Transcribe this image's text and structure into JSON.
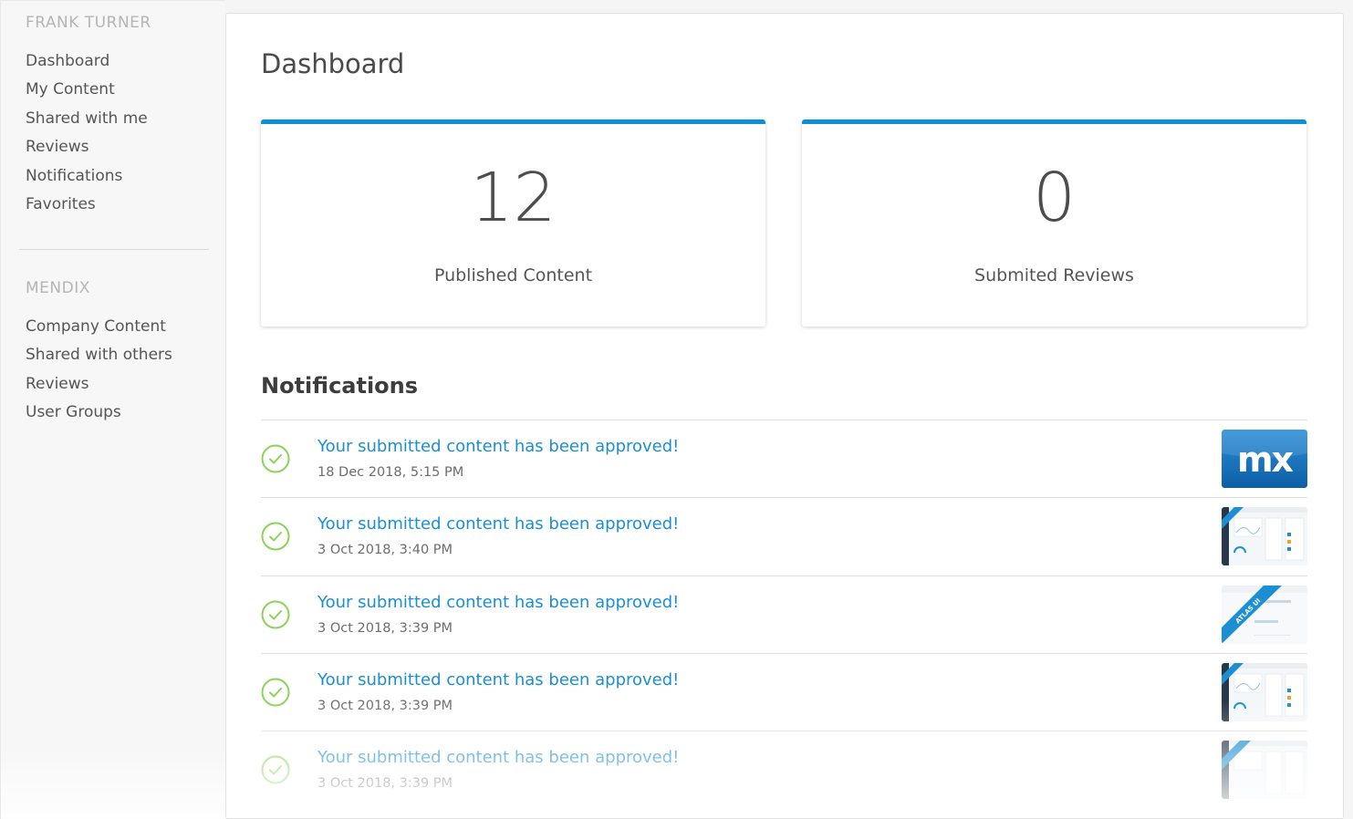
{
  "sidebar": {
    "user_heading": "FRANK TURNER",
    "user_items": [
      "Dashboard",
      "My Content",
      "Shared with me",
      "Reviews",
      "Notifications",
      "Favorites"
    ],
    "org_heading": "MENDIX",
    "org_items": [
      "Company Content",
      "Shared with others",
      "Reviews",
      "User Groups"
    ]
  },
  "main": {
    "title": "Dashboard",
    "stats": [
      {
        "value": "12",
        "label": "Published Content"
      },
      {
        "value": "0",
        "label": "Submited Reviews"
      }
    ],
    "notifications_title": "Notifications",
    "notifications": [
      {
        "text": "Your submitted content has been approved!",
        "date": "18 Dec 2018, 5:15 PM",
        "thumb": "mx-logo"
      },
      {
        "text": "Your submitted content has been approved!",
        "date": "3 Oct 2018, 3:40 PM",
        "thumb": "atlas-ui-screenshot"
      },
      {
        "text": "Your submitted content has been approved!",
        "date": "3 Oct 2018, 3:39 PM",
        "thumb": "atlas-ui-screenshot"
      },
      {
        "text": "Your submitted content has been approved!",
        "date": "3 Oct 2018, 3:39 PM",
        "thumb": "atlas-ui-screenshot"
      },
      {
        "text": "Your submitted content has been approved!",
        "date": "3 Oct 2018, 3:39 PM",
        "thumb": "atlas-ui-screenshot"
      }
    ]
  },
  "colors": {
    "accent": "#0d8fd6",
    "link": "#1b8fd2",
    "success": "#8dd35a"
  }
}
